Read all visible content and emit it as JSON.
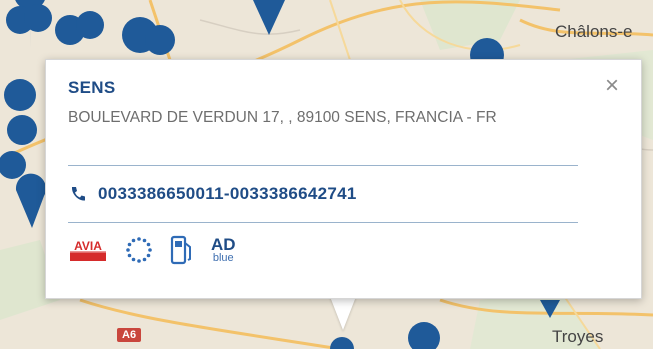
{
  "map": {
    "cities": {
      "chalons": "Châlons-e",
      "troyes": "Troyes"
    },
    "road_label": "A6",
    "colors": {
      "marker": "#1f5a99",
      "land": "#ede6d8",
      "road": "#f3c26a"
    }
  },
  "popup": {
    "name": "SENS",
    "address": "BOULEVARD DE VERDUN 17, , 89100 SENS, FRANCIA - FR",
    "phone": "0033386650011-0033386642741",
    "close_icon": "×",
    "services": [
      {
        "icon": "avia-icon",
        "label": "AVIA"
      },
      {
        "icon": "eu-stars-icon"
      },
      {
        "icon": "fuel-pump-icon"
      },
      {
        "icon": "adblue-icon",
        "line1": "AD",
        "line2": "blue"
      }
    ],
    "colors": {
      "title": "#1f4c86",
      "text": "#6e6e6e",
      "divider": "#9ab3cc"
    }
  }
}
